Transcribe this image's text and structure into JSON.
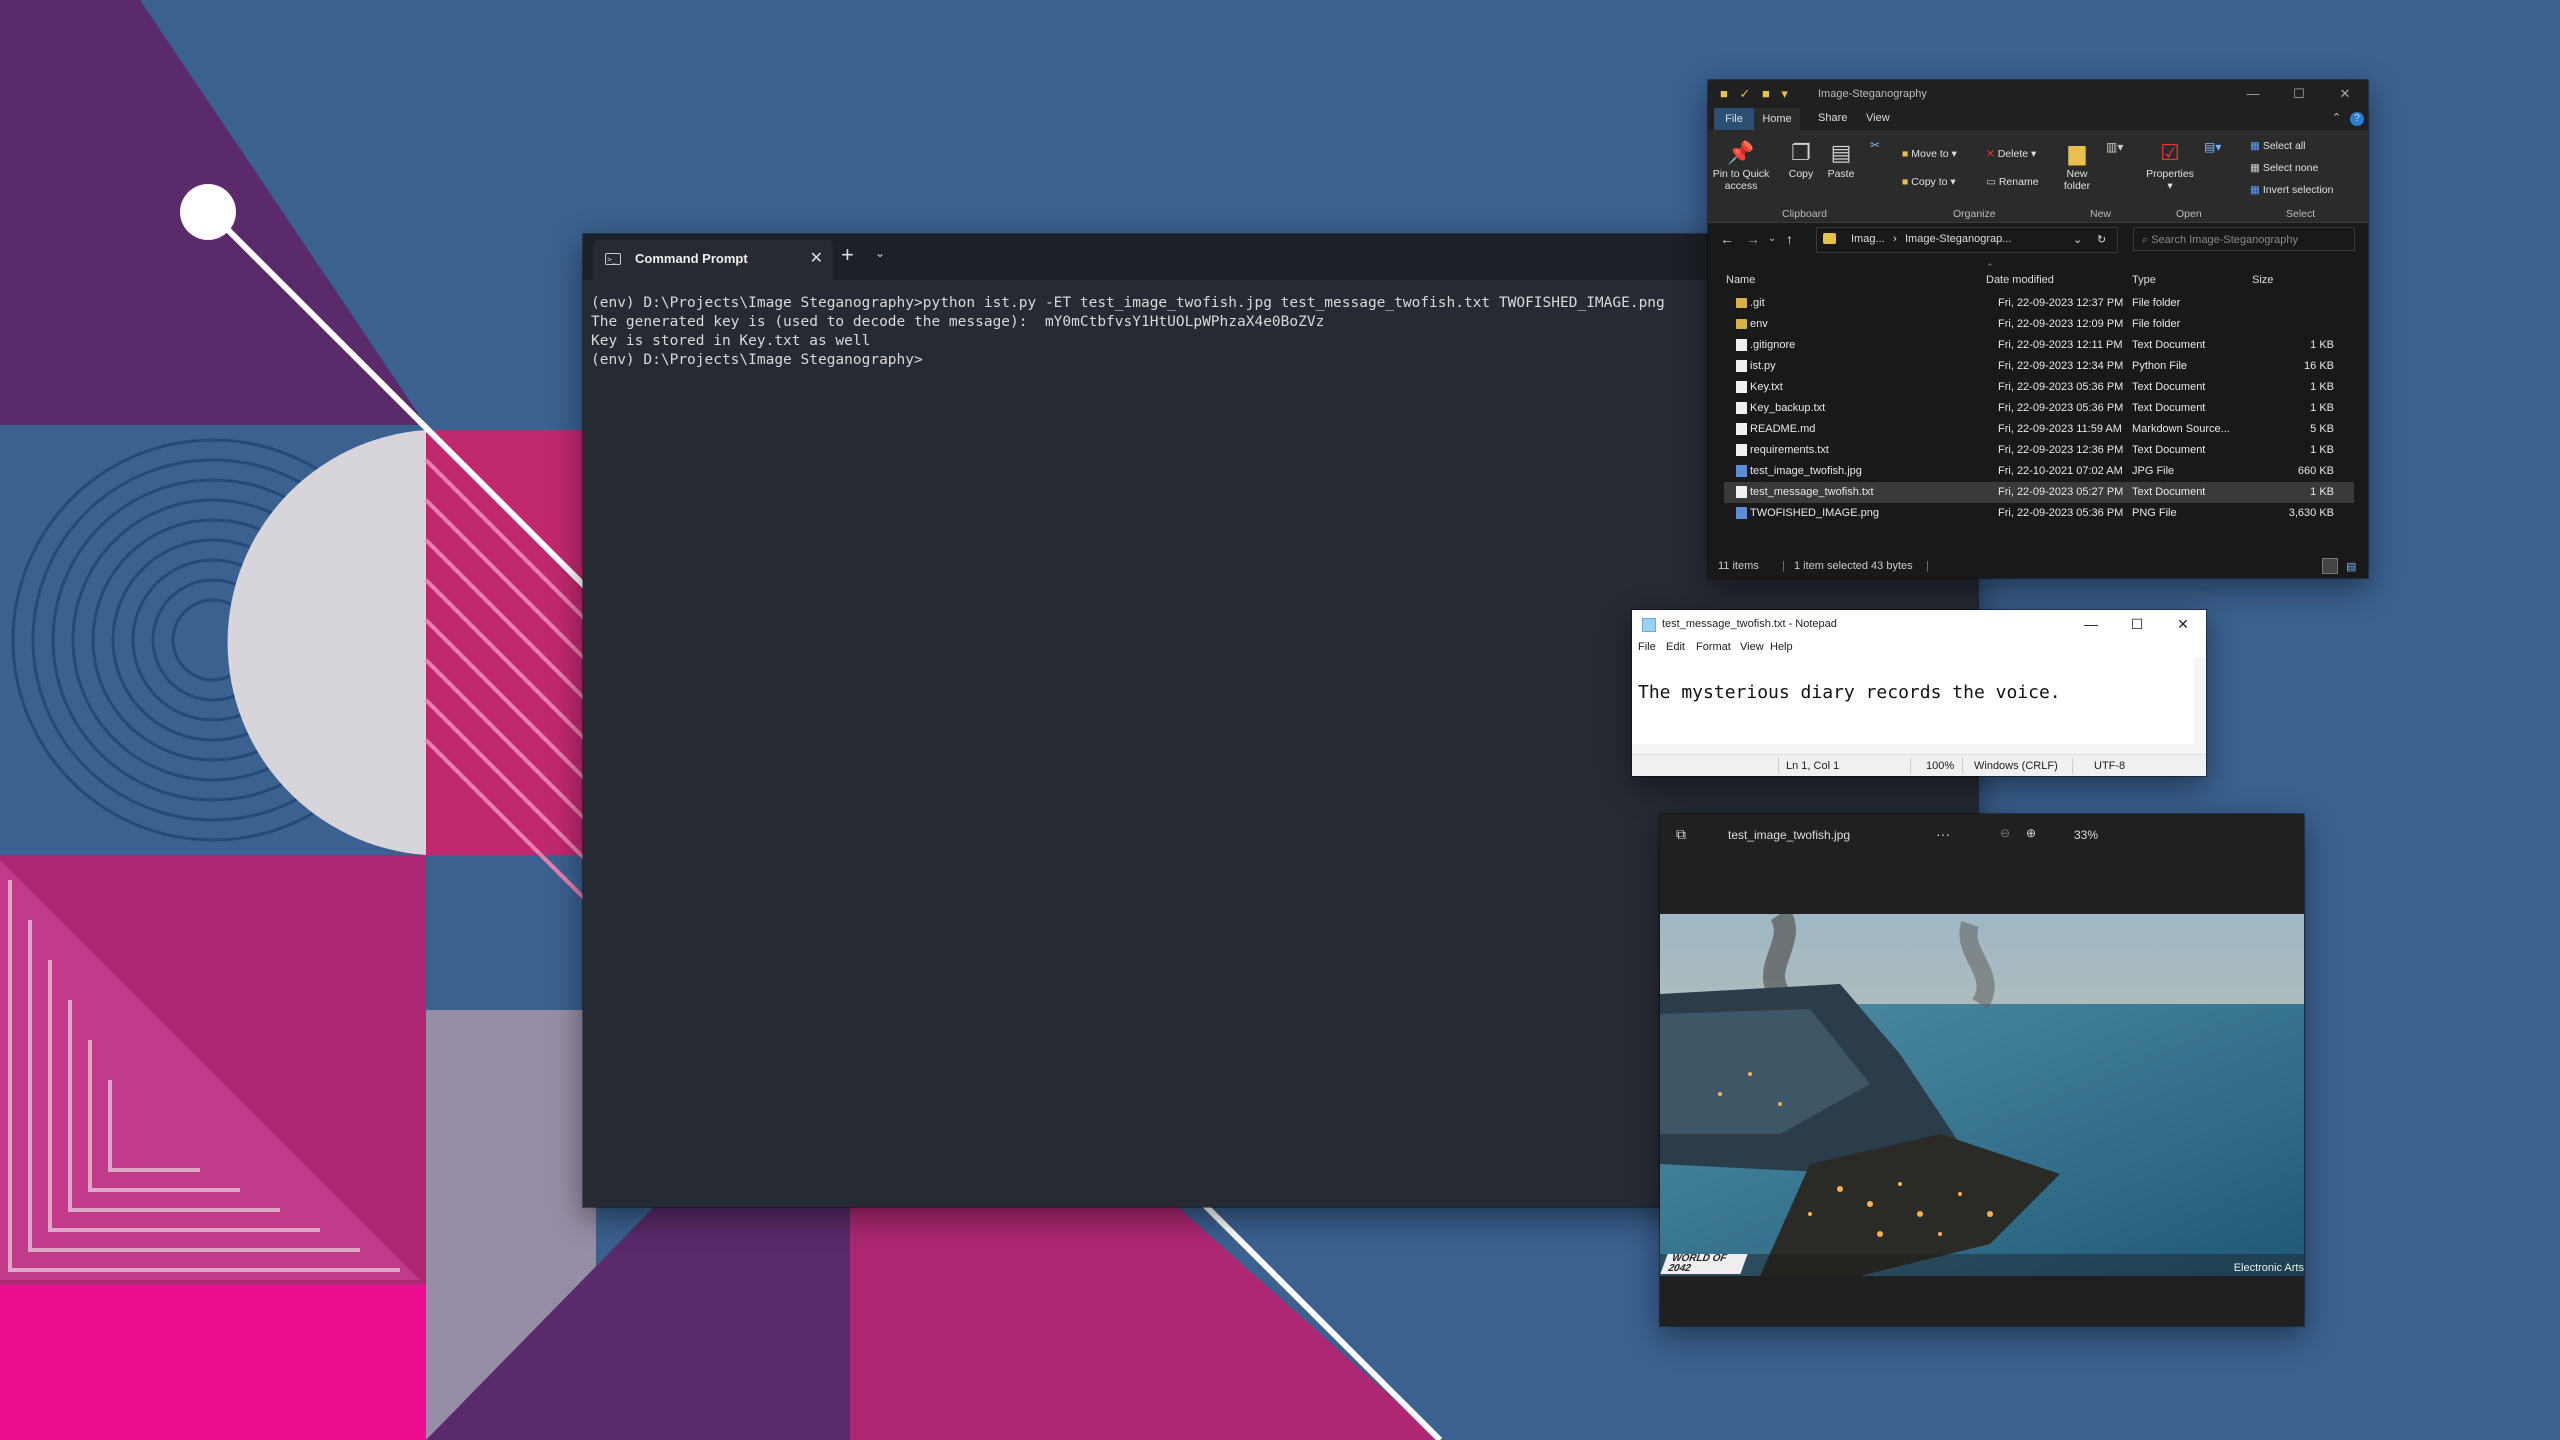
{
  "terminal": {
    "tab_title": "Command Prompt",
    "lines": [
      "(env) D:\\Projects\\Image Steganography>python ist.py -ET test_image_twofish.jpg test_message_twofish.txt TWOFISHED_IMAGE.png",
      "",
      "The generated key is (used to decode the message):  mY0mCtbfvsY1HtUOLpWPhzaX4e0BoZVz",
      "Key is stored in Key.txt as well",
      "",
      "(env) D:\\Projects\\Image Steganography>"
    ]
  },
  "explorer": {
    "title": "Image-Steganography",
    "ribbon_tabs": [
      "File",
      "Home",
      "Share",
      "View"
    ],
    "buttons": {
      "pin": "Pin to Quick access",
      "copy": "Copy",
      "paste": "Paste",
      "move_to": "Move to",
      "copy_to": "Copy to",
      "delete": "Delete",
      "rename": "Rename",
      "new_folder": "New folder",
      "properties": "Properties",
      "select_all": "Select all",
      "select_none": "Select none",
      "invert_selection": "Invert selection"
    },
    "groups": [
      "Clipboard",
      "Organize",
      "New",
      "Open",
      "Select"
    ],
    "address": [
      "Imag...",
      "Image-Steganograp..."
    ],
    "search_placeholder": "Search Image-Steganography",
    "columns": [
      "Name",
      "Date modified",
      "Type",
      "Size"
    ],
    "files": [
      {
        "name": ".git",
        "date": "Fri, 22-09-2023 12:37 PM",
        "type": "File folder",
        "size": "",
        "icon": "folder"
      },
      {
        "name": "env",
        "date": "Fri, 22-09-2023 12:09 PM",
        "type": "File folder",
        "size": "",
        "icon": "folder"
      },
      {
        "name": ".gitignore",
        "date": "Fri, 22-09-2023 12:11 PM",
        "type": "Text Document",
        "size": "1 KB",
        "icon": "doc"
      },
      {
        "name": "ist.py",
        "date": "Fri, 22-09-2023 12:34 PM",
        "type": "Python File",
        "size": "16 KB",
        "icon": "doc"
      },
      {
        "name": "Key.txt",
        "date": "Fri, 22-09-2023 05:36 PM",
        "type": "Text Document",
        "size": "1 KB",
        "icon": "doc"
      },
      {
        "name": "Key_backup.txt",
        "date": "Fri, 22-09-2023 05:36 PM",
        "type": "Text Document",
        "size": "1 KB",
        "icon": "doc"
      },
      {
        "name": "README.md",
        "date": "Fri, 22-09-2023 11:59 AM",
        "type": "Markdown Source...",
        "size": "5 KB",
        "icon": "doc"
      },
      {
        "name": "requirements.txt",
        "date": "Fri, 22-09-2023 12:36 PM",
        "type": "Text Document",
        "size": "1 KB",
        "icon": "doc"
      },
      {
        "name": "test_image_twofish.jpg",
        "date": "Fri, 22-10-2021 07:02 AM",
        "type": "JPG File",
        "size": "660 KB",
        "icon": "img"
      },
      {
        "name": "test_message_twofish.txt",
        "date": "Fri, 22-09-2023 05:27 PM",
        "type": "Text Document",
        "size": "1 KB",
        "icon": "doc"
      },
      {
        "name": "TWOFISHED_IMAGE.png",
        "date": "Fri, 22-09-2023 05:36 PM",
        "type": "PNG File",
        "size": "3,630 KB",
        "icon": "img"
      }
    ],
    "selected_file": "test_message_twofish.txt",
    "status": {
      "items": "11 items",
      "selected": "1 item selected  43 bytes"
    }
  },
  "notepad": {
    "title": "test_message_twofish.txt - Notepad",
    "menu": [
      "File",
      "Edit",
      "Format",
      "View",
      "Help"
    ],
    "content": "The mysterious diary records the voice.",
    "status": {
      "position": "Ln 1, Col 1",
      "zoom": "100%",
      "line_ending": "Windows (CRLF)",
      "encoding": "UTF-8"
    }
  },
  "photos": {
    "title": "test_image_twofish.jpg",
    "more": "···",
    "zoom": "33%",
    "watermark": "WORLD OF 2042",
    "credit": "Electronic Arts"
  }
}
